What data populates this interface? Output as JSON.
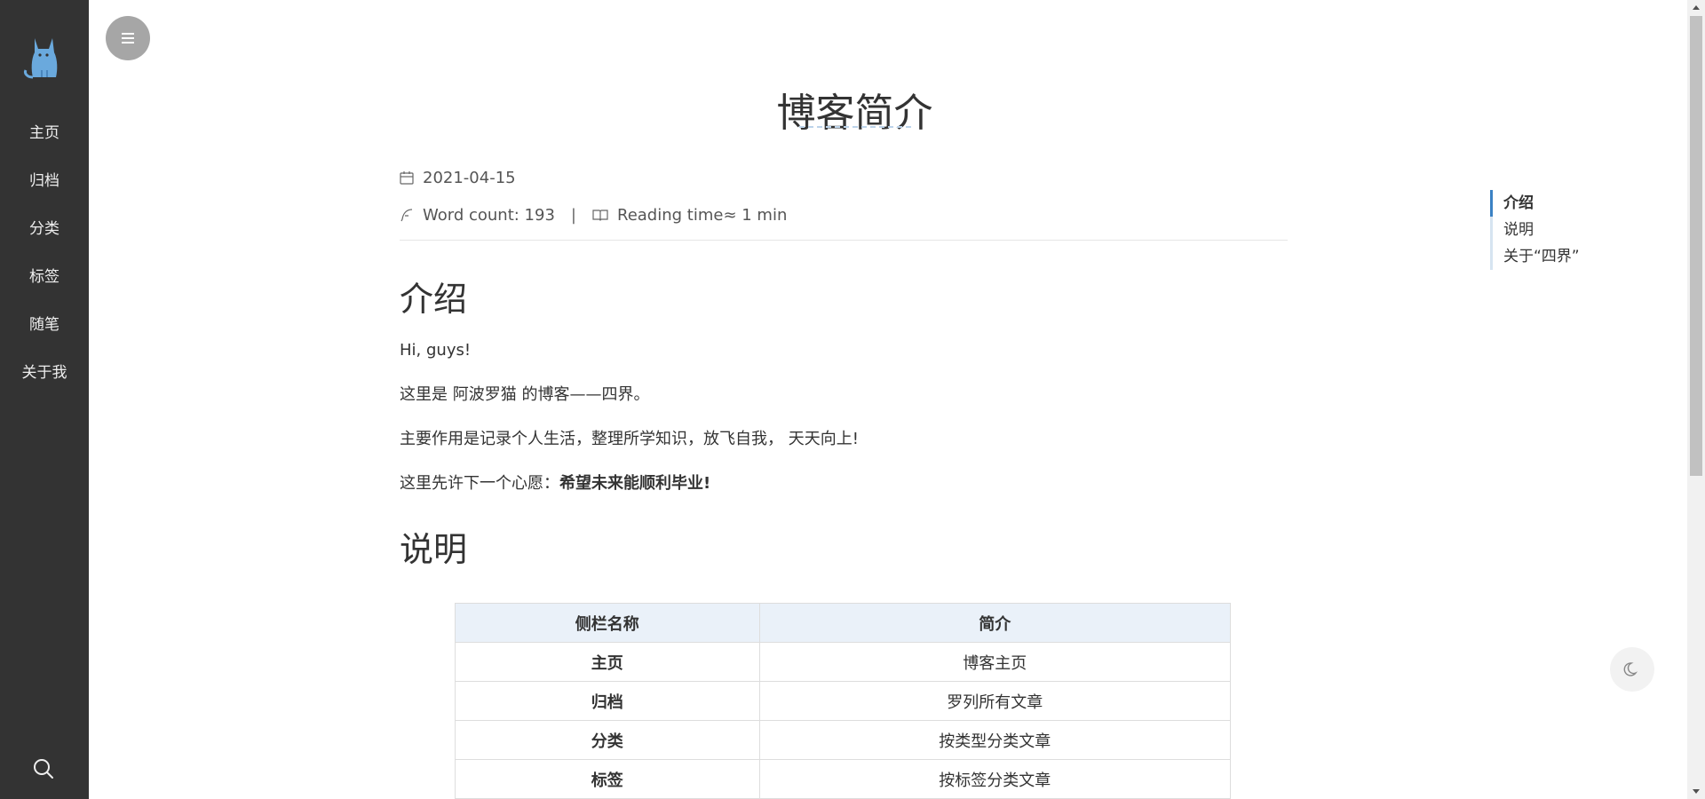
{
  "sidebar": {
    "logo_icon": "cat-logo-icon",
    "items": [
      {
        "label": "主页"
      },
      {
        "label": "归档"
      },
      {
        "label": "分类"
      },
      {
        "label": "标签"
      },
      {
        "label": "随笔"
      },
      {
        "label": "关于我"
      }
    ],
    "search_icon": "search-icon"
  },
  "menu_toggle_icon": "hamburger-menu-icon",
  "article": {
    "title": "博客简介",
    "date": "2021-04-15",
    "word_count": "Word count: 193",
    "separator": "|",
    "reading_time": "Reading time≈ 1 min",
    "sections": {
      "intro_heading": "介绍",
      "intro_p1": "Hi, guys!",
      "intro_p2": "这里是 阿波罗猫 的博客——四界。",
      "intro_p3": "主要作用是记录个人生活，整理所学知识，放飞自我， 天天向上!",
      "intro_p4_prefix": "这里先许下一个心愿：",
      "intro_p4_bold": "希望未来能顺利毕业!",
      "desc_heading": "说明"
    },
    "table": {
      "headers": [
        "侧栏名称",
        "简介"
      ],
      "rows": [
        [
          "主页",
          "博客主页"
        ],
        [
          "归档",
          "罗列所有文章"
        ],
        [
          "分类",
          "按类型分类文章"
        ],
        [
          "标签",
          "按标签分类文章"
        ]
      ]
    }
  },
  "toc": {
    "items": [
      {
        "label": "介绍"
      },
      {
        "label": "说明"
      },
      {
        "label": "关于“四界”"
      }
    ]
  },
  "dark_mode_icon": "moon-icon",
  "colors": {
    "sidebar_bg": "#333333",
    "toc_accent": "#3b82c4",
    "table_header_bg": "#eaf1f9"
  }
}
